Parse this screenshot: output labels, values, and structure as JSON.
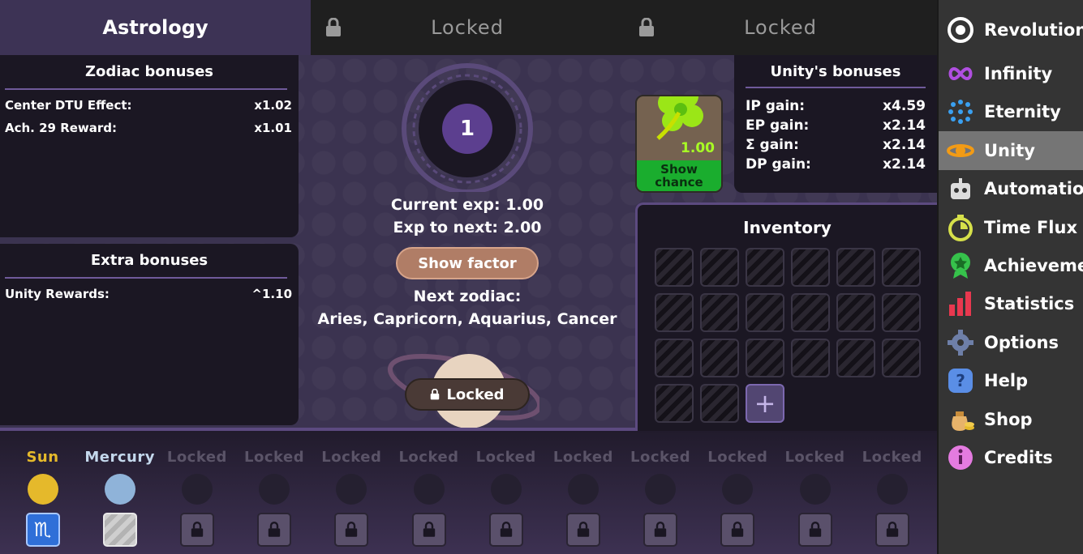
{
  "tabs": {
    "astrology": "Astrology",
    "locked_1": "Locked",
    "locked_2": "Locked"
  },
  "zodiac_bonuses": {
    "title": "Zodiac bonuses",
    "rows": [
      {
        "label": "Center DTU Effect:",
        "value": "x1.02"
      },
      {
        "label": "Ach. 29 Reward:",
        "value": "x1.01"
      }
    ]
  },
  "extra_bonuses": {
    "title": "Extra bonuses",
    "rows": [
      {
        "label": "Unity Rewards:",
        "value": "^1.10"
      }
    ]
  },
  "wheel": {
    "level": "1",
    "current_exp": "Current exp: 1.00",
    "exp_to_next": "Exp to next: 2.00",
    "show_factor": "Show factor",
    "next_zodiac_label": "Next zodiac:",
    "next_zodiac_list": "Aries, Capricorn, Aquarius, Cancer",
    "locked_button": "Locked"
  },
  "clover": {
    "value": "1.00",
    "show_chance": "Show chance"
  },
  "unity_bonuses": {
    "title": "Unity's bonuses",
    "rows": [
      {
        "label": "IP gain:",
        "value": "x4.59"
      },
      {
        "label": "EP gain:",
        "value": "x2.14"
      },
      {
        "label": "Σ gain:",
        "value": "x2.14"
      },
      {
        "label": "DP gain:",
        "value": "x2.14"
      }
    ]
  },
  "inventory": {
    "title": "Inventory",
    "add_label": "+"
  },
  "planets": [
    {
      "name": "Sun",
      "color": "#e5b92b"
    },
    {
      "name": "Mercury",
      "color": "#8fb3d9"
    },
    {
      "name": "Locked"
    },
    {
      "name": "Locked"
    },
    {
      "name": "Locked"
    },
    {
      "name": "Locked"
    },
    {
      "name": "Locked"
    },
    {
      "name": "Locked"
    },
    {
      "name": "Locked"
    },
    {
      "name": "Locked"
    },
    {
      "name": "Locked"
    },
    {
      "name": "Locked"
    }
  ],
  "sidebar": {
    "items": [
      {
        "label": "Revolution",
        "icon": "revolution-icon"
      },
      {
        "label": "Infinity",
        "icon": "infinity-icon"
      },
      {
        "label": "Eternity",
        "icon": "eternity-icon"
      },
      {
        "label": "Unity",
        "icon": "unity-icon",
        "active": true
      },
      {
        "label": "Automation",
        "icon": "robot-icon"
      },
      {
        "label": "Time Flux",
        "icon": "stopwatch-icon"
      },
      {
        "label": "Achievements",
        "icon": "medal-icon"
      },
      {
        "label": "Statistics",
        "icon": "bar-chart-icon"
      },
      {
        "label": "Options",
        "icon": "gear-icon"
      },
      {
        "label": "Help",
        "icon": "help-icon"
      },
      {
        "label": "Shop",
        "icon": "money-bag-icon"
      },
      {
        "label": "Credits",
        "icon": "info-icon"
      }
    ]
  },
  "colors": {
    "accent_purple": "#5c3f8f",
    "sun": "#e5b92b",
    "clover_green": "#a8ff24",
    "show_chance_bg": "#1aad2e"
  }
}
